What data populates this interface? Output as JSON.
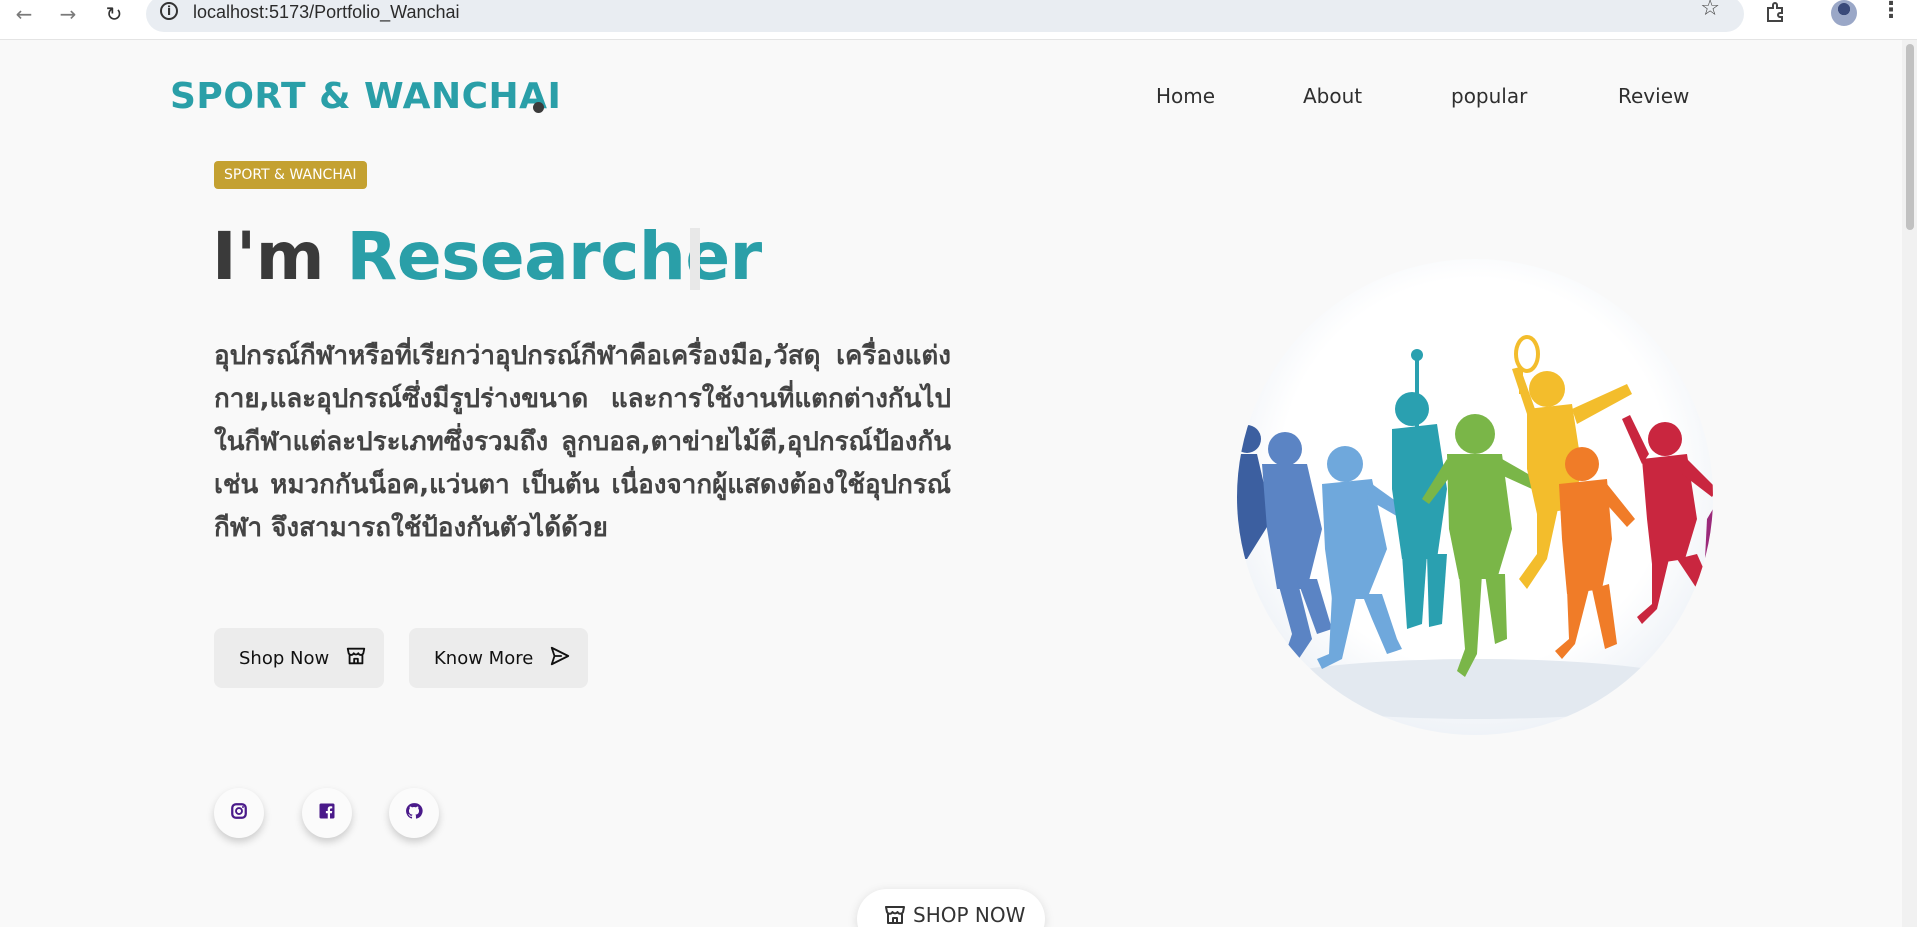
{
  "browser": {
    "url": "localhost:5173/Portfolio_Wanchai"
  },
  "header": {
    "logo": "SPORT & WANCHAI",
    "nav": [
      "Home",
      "About",
      "popular",
      "Review"
    ]
  },
  "hero": {
    "tag": "SPORT & WANCHAI",
    "headline_prefix": "I'm ",
    "headline_accent": "Researcher",
    "description": "อุปกรณ์กีฬาหรือที่เรียกว่าอุปกรณ์กีฬาคือเครื่องมือ,วัสดุ เครื่องแต่งกาย,และอุปกรณ์ซึ่งมีรูปร่างขนาด และการใช้งานที่แตกต่างกันไปในกีฬาแต่ละประเภทซึ่งรวมถึง ลูกบอล,ตาข่ายไม้ตี,อุปกรณ์ป้องกัน เช่น หมวกกันน็อค,แว่นตา เป็นต้น เนื่องจากผู้แสดงต้องใช้อุปกรณ์กีฬา จึงสามารถใช้ป้องกันตัวได้ด้วย",
    "buttons": {
      "shop_now": "Shop Now",
      "know_more": "Know More"
    }
  },
  "social": {
    "icons": [
      "instagram-icon",
      "facebook-icon",
      "github-icon"
    ]
  },
  "floating": {
    "shop_now": "SHOP NOW"
  },
  "colors": {
    "accent": "#2a9fa8",
    "tag_bg": "#c4a131",
    "button_bg": "#ececec",
    "social_icon": "#4a1a8a"
  }
}
